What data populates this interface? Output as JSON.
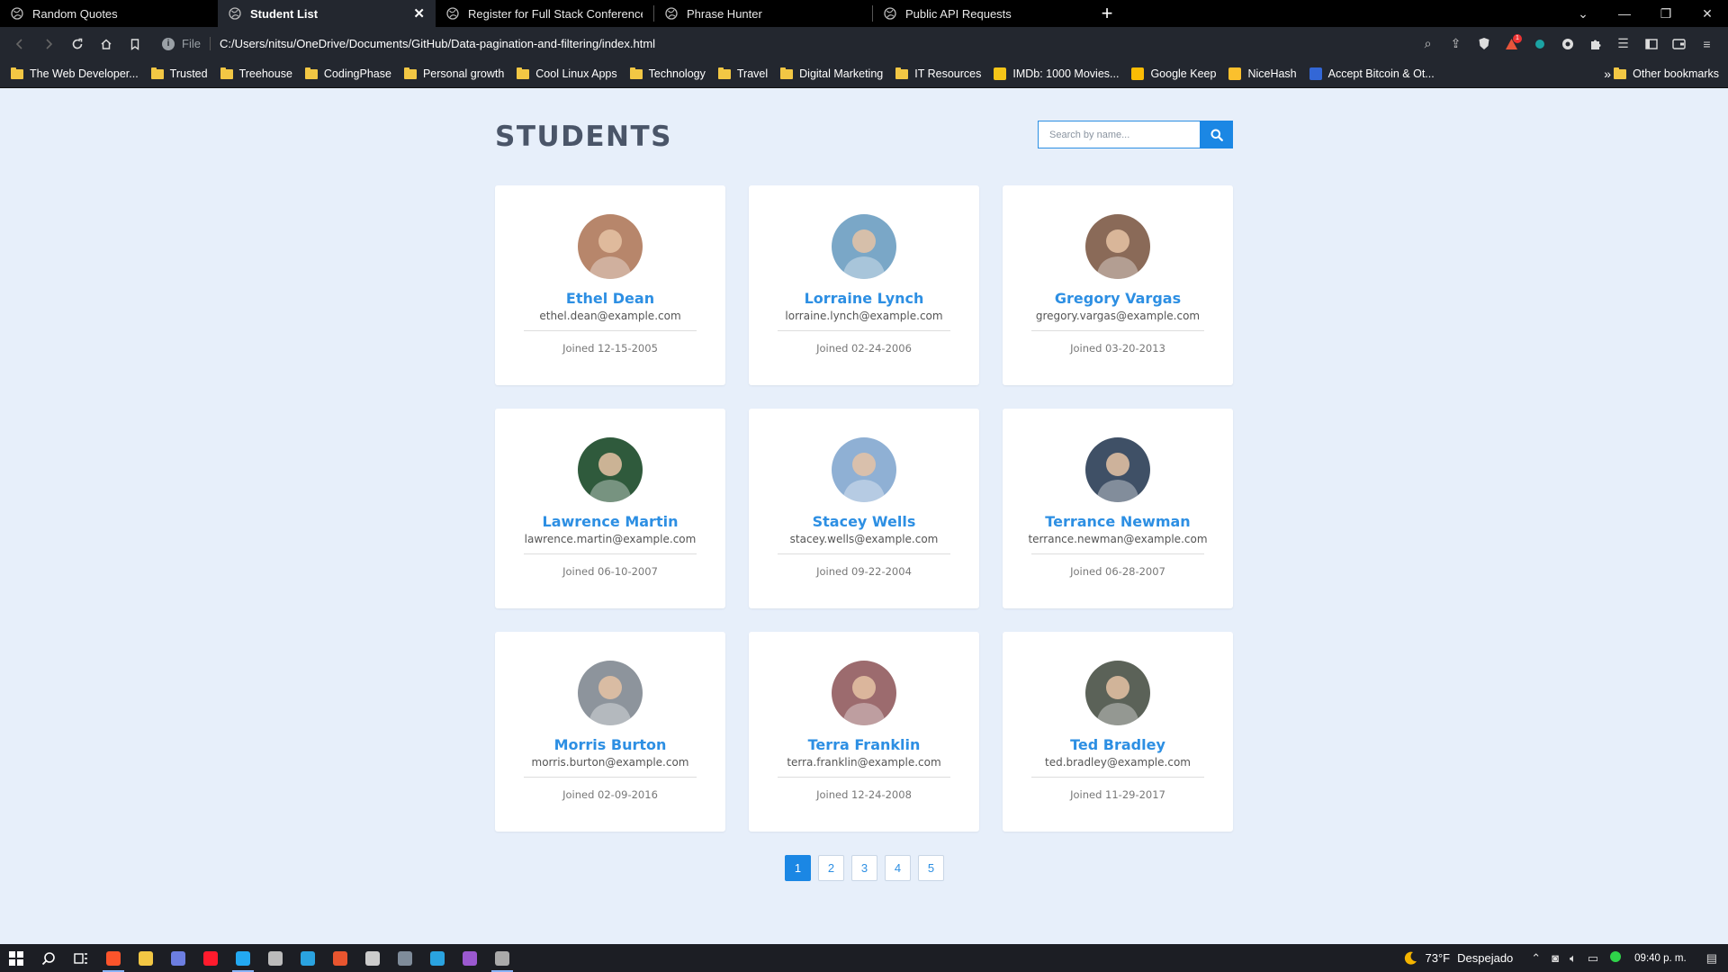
{
  "browser": {
    "tabs": [
      {
        "title": "Random Quotes",
        "active": false
      },
      {
        "title": "Student List",
        "active": true
      },
      {
        "title": "Register for Full Stack Conference",
        "active": false
      },
      {
        "title": "Phrase Hunter",
        "active": false
      },
      {
        "title": "Public API Requests",
        "active": false
      }
    ],
    "new_tab_label": "+",
    "url_scheme": "File",
    "url": "C:/Users/nitsu/OneDrive/Documents/GitHub/Data-pagination-and-filtering/index.html",
    "brave_badge": "1",
    "bookmarks": [
      {
        "label": "The Web Developer...",
        "icon": "folder-icon"
      },
      {
        "label": "Trusted",
        "icon": "folder-icon"
      },
      {
        "label": "Treehouse",
        "icon": "folder-icon"
      },
      {
        "label": "CodingPhase",
        "icon": "folder-icon"
      },
      {
        "label": "Personal growth",
        "icon": "folder-icon"
      },
      {
        "label": "Cool Linux Apps",
        "icon": "folder-icon"
      },
      {
        "label": "Technology",
        "icon": "folder-icon"
      },
      {
        "label": "Travel",
        "icon": "folder-icon"
      },
      {
        "label": "Digital Marketing",
        "icon": "folder-icon"
      },
      {
        "label": "IT Resources",
        "icon": "folder-icon"
      },
      {
        "label": "IMDb: 1000 Movies...",
        "icon": "imdb-icon",
        "color": "#f5c518"
      },
      {
        "label": "Google Keep",
        "icon": "keep-icon",
        "color": "#fbbc04"
      },
      {
        "label": "NiceHash",
        "icon": "nicehash-icon",
        "color": "#fbc02d"
      },
      {
        "label": "Accept Bitcoin & Ot...",
        "icon": "bitcoin-icon",
        "color": "#3367d6"
      }
    ],
    "bookmarks_more": "»",
    "other_bookmarks": "Other bookmarks"
  },
  "page": {
    "title": "STUDENTS",
    "search_placeholder": "Search by name...",
    "students": [
      {
        "name": "Ethel Dean",
        "email": "ethel.dean@example.com",
        "joined": "Joined 12-15-2005",
        "avatar_color": "#b7866b"
      },
      {
        "name": "Lorraine Lynch",
        "email": "lorraine.lynch@example.com",
        "joined": "Joined 02-24-2006",
        "avatar_color": "#7aa7c7"
      },
      {
        "name": "Gregory Vargas",
        "email": "gregory.vargas@example.com",
        "joined": "Joined 03-20-2013",
        "avatar_color": "#8a6a58"
      },
      {
        "name": "Lawrence Martin",
        "email": "lawrence.martin@example.com",
        "joined": "Joined 06-10-2007",
        "avatar_color": "#2f5a3c"
      },
      {
        "name": "Stacey Wells",
        "email": "stacey.wells@example.com",
        "joined": "Joined 09-22-2004",
        "avatar_color": "#8fb0d4"
      },
      {
        "name": "Terrance Newman",
        "email": "terrance.newman@example.com",
        "joined": "Joined 06-28-2007",
        "avatar_color": "#3f5066"
      },
      {
        "name": "Morris Burton",
        "email": "morris.burton@example.com",
        "joined": "Joined 02-09-2016",
        "avatar_color": "#8d949c"
      },
      {
        "name": "Terra Franklin",
        "email": "terra.franklin@example.com",
        "joined": "Joined 12-24-2008",
        "avatar_color": "#9c6b6e"
      },
      {
        "name": "Ted Bradley",
        "email": "ted.bradley@example.com",
        "joined": "Joined 11-29-2017",
        "avatar_color": "#5b6258"
      }
    ],
    "pages": [
      "1",
      "2",
      "3",
      "4",
      "5"
    ],
    "active_page": "1"
  },
  "taskbar": {
    "apps": [
      {
        "name": "start-icon",
        "color": "#ffffff"
      },
      {
        "name": "search-icon",
        "color": "#ffffff"
      },
      {
        "name": "task-view-icon",
        "color": "#ffffff"
      },
      {
        "name": "brave-icon",
        "color": "#fb542b"
      },
      {
        "name": "file-explorer-icon",
        "color": "#f2c744"
      },
      {
        "name": "app-icon",
        "color": "#6c7ee1"
      },
      {
        "name": "opera-icon",
        "color": "#ff1b2d"
      },
      {
        "name": "vscode-icon",
        "color": "#23a9f2"
      },
      {
        "name": "app-icon",
        "color": "#bbbbbb"
      },
      {
        "name": "telegram-icon",
        "color": "#2aa3e0"
      },
      {
        "name": "app-icon",
        "color": "#e8552f"
      },
      {
        "name": "app-icon",
        "color": "#cccccc"
      },
      {
        "name": "calculator-icon",
        "color": "#7f8c9a"
      },
      {
        "name": "telegram-icon",
        "color": "#2aa3e0"
      },
      {
        "name": "github-desktop-icon",
        "color": "#9b59d0"
      },
      {
        "name": "app-icon",
        "color": "#aaaaaa"
      }
    ],
    "temperature": "73°F",
    "weather_text": "Despejado",
    "time": "09:40 p. m."
  }
}
